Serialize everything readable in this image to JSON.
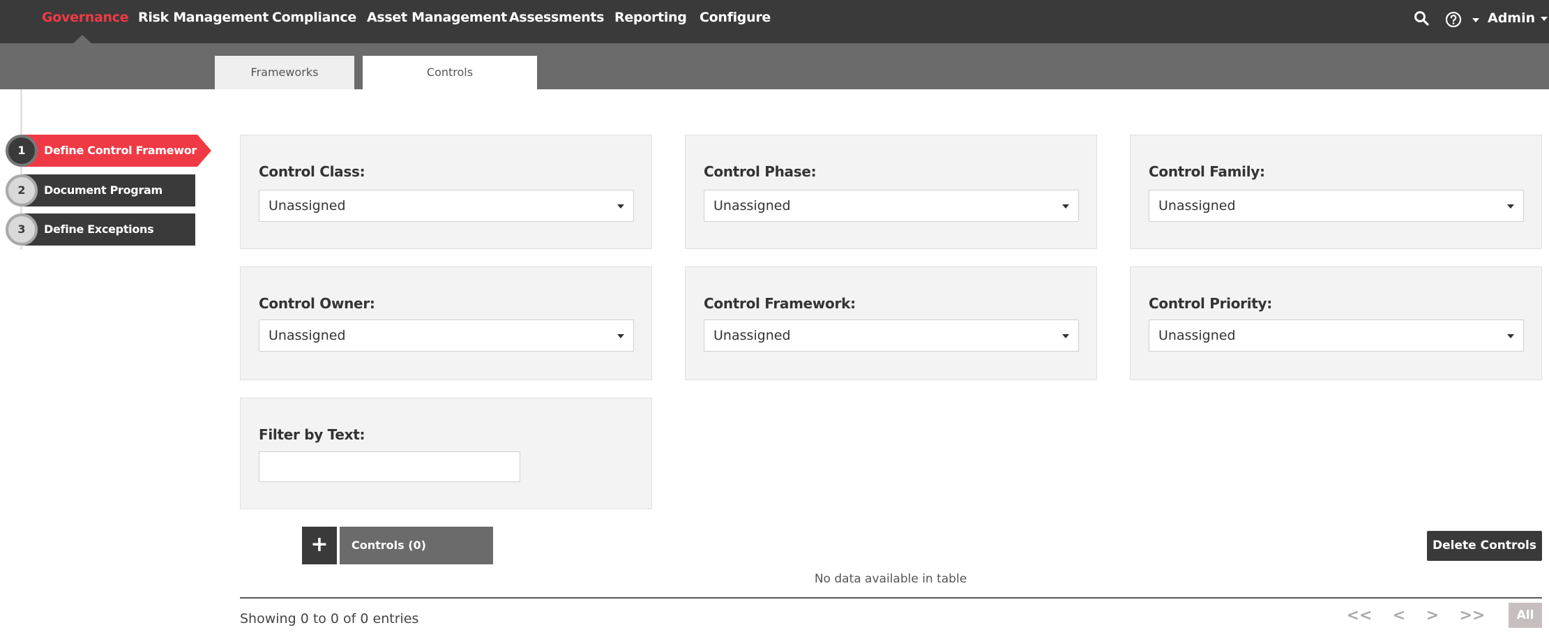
{
  "nav": {
    "items": [
      {
        "label": "Governance",
        "active": true
      },
      {
        "label": "Risk Management",
        "active": false
      },
      {
        "label": "Compliance",
        "active": false
      },
      {
        "label": "Asset Management",
        "active": false
      },
      {
        "label": "Assessments",
        "active": false
      },
      {
        "label": "Reporting",
        "active": false
      },
      {
        "label": "Configure",
        "active": false
      }
    ],
    "user_label": "Admin",
    "search_icon": "search-icon",
    "help_icon": "help-circle-icon"
  },
  "tabs": [
    {
      "label": "Frameworks",
      "active": false
    },
    {
      "label": "Controls",
      "active": true
    }
  ],
  "steps": [
    {
      "number": "1",
      "label": "Define Control Frameworks",
      "active": true
    },
    {
      "number": "2",
      "label": "Document Program",
      "active": false
    },
    {
      "number": "3",
      "label": "Define Exceptions",
      "active": false
    }
  ],
  "filters": {
    "control_class": {
      "label": "Control Class:",
      "value": "Unassigned"
    },
    "control_phase": {
      "label": "Control Phase:",
      "value": "Unassigned"
    },
    "control_family": {
      "label": "Control Family:",
      "value": "Unassigned"
    },
    "control_owner": {
      "label": "Control Owner:",
      "value": "Unassigned"
    },
    "control_framework": {
      "label": "Control Framework:",
      "value": "Unassigned"
    },
    "control_priority": {
      "label": "Control Priority:",
      "value": "Unassigned"
    },
    "filter_text": {
      "label": "Filter by Text:",
      "value": ""
    }
  },
  "table": {
    "add_label": "+",
    "tab_label": "Controls (0)",
    "delete_label": "Delete Controls",
    "empty_message": "No data available in table",
    "info": "Showing 0 to 0 of 0 entries",
    "pager": {
      "first": "<<",
      "prev": "<",
      "next": ">",
      "last": ">>",
      "all": "All"
    }
  },
  "colors": {
    "accent": "#ef3a45",
    "nav_bg": "#3a3a3a",
    "subbar_bg": "#6b6b6b",
    "panel_bg": "#f3f3f3"
  }
}
